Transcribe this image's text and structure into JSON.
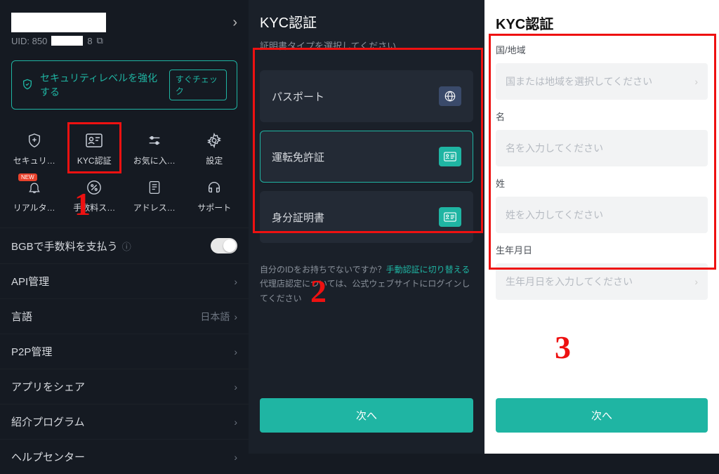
{
  "panel1": {
    "uid_prefix": "UID: 850",
    "uid_suffix": "8",
    "security_banner": "セキュリティレベルを強化する",
    "security_check": "すぐチェック",
    "grid": [
      {
        "label": "セキュリ…",
        "icon": "shield-plus-icon"
      },
      {
        "label": "KYC認証",
        "icon": "id-card-icon",
        "highlight": true
      },
      {
        "label": "お気に入…",
        "icon": "sliders-icon"
      },
      {
        "label": "設定",
        "icon": "gear-icon"
      },
      {
        "label": "リアルタ…",
        "icon": "bell-icon",
        "badge": "NEW"
      },
      {
        "label": "手数料ス…",
        "icon": "percent-icon"
      },
      {
        "label": "アドレス…",
        "icon": "addressbook-icon"
      },
      {
        "label": "サポート",
        "icon": "headset-icon"
      }
    ],
    "rows": {
      "bgb": "BGBで手数料を支払う",
      "api": "API管理",
      "lang": "言語",
      "lang_value": "日本語",
      "p2p": "P2P管理",
      "share": "アプリをシェア",
      "referral": "紹介プログラム",
      "help": "ヘルプセンター"
    }
  },
  "panel2": {
    "title": "KYC認証",
    "subtitle": "証明書タイプを選択してください",
    "options": [
      {
        "label": "パスポート",
        "icon": "globe-icon",
        "selected": false
      },
      {
        "label": "運転免許証",
        "icon": "license-icon",
        "selected": true
      },
      {
        "label": "身分証明書",
        "icon": "id-icon",
        "selected": false
      }
    ],
    "help_prefix": "自分のIDをお持ちでないですか？",
    "help_link": "手動認証に切り替える",
    "help_rest": "代理店認定については、公式ウェブサイトにログインしてください",
    "button": "次へ"
  },
  "panel3": {
    "title": "KYC認証",
    "fields": [
      {
        "label": "国/地域",
        "placeholder": "国または地域を選択してください",
        "chevron": true
      },
      {
        "label": "名",
        "placeholder": "名を入力してください",
        "chevron": false
      },
      {
        "label": "姓",
        "placeholder": "姓を入力してください",
        "chevron": false
      },
      {
        "label": "生年月日",
        "placeholder": "生年月日を入力してください",
        "chevron": true
      }
    ],
    "button": "次へ"
  },
  "steps": {
    "s1": "1",
    "s2": "2",
    "s3": "3"
  }
}
